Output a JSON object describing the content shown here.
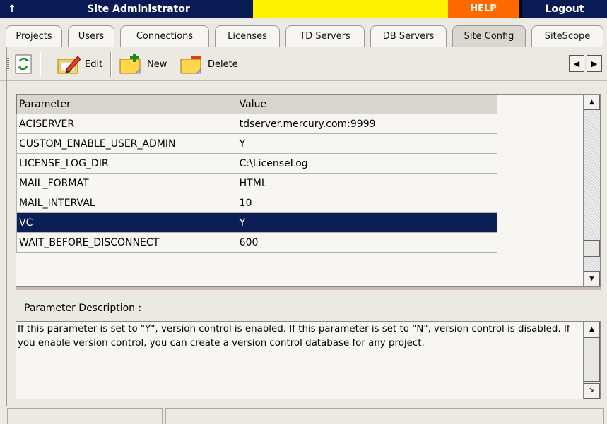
{
  "titlebar": {
    "up_glyph": "↑",
    "title": "Site Administrator",
    "help": "HELP",
    "logout": "Logout"
  },
  "tabs": [
    {
      "label": "Projects",
      "active": false
    },
    {
      "label": "Users",
      "active": false
    },
    {
      "label": "Connections",
      "active": false
    },
    {
      "label": "Licenses",
      "active": false
    },
    {
      "label": "TD Servers",
      "active": false
    },
    {
      "label": "DB Servers",
      "active": false
    },
    {
      "label": "Site Config",
      "active": true
    },
    {
      "label": "SiteScope",
      "active": false
    }
  ],
  "toolbar": {
    "refresh_icon": "refresh-icon",
    "edit_label": "Edit",
    "new_label": "New",
    "delete_label": "Delete",
    "prev_glyph": "◀",
    "next_glyph": "▶"
  },
  "grid": {
    "columns": [
      "Parameter",
      "Value"
    ],
    "rows": [
      {
        "parameter": "ACISERVER",
        "value": "tdserver.mercury.com:9999"
      },
      {
        "parameter": "CUSTOM_ENABLE_USER_ADMIN",
        "value": "Y"
      },
      {
        "parameter": "LICENSE_LOG_DIR",
        "value": "C:\\LicenseLog"
      },
      {
        "parameter": "MAIL_FORMAT",
        "value": "HTML"
      },
      {
        "parameter": "MAIL_INTERVAL",
        "value": "10"
      },
      {
        "parameter": "VC",
        "value": "Y"
      },
      {
        "parameter": "WAIT_BEFORE_DISCONNECT",
        "value": "600"
      }
    ],
    "selected_index": 5
  },
  "description": {
    "label": "Parameter Description :",
    "text": "If this parameter is set to \"Y\", version control is enabled. If this parameter is set to \"N\", version control is disabled. If you enable version control, you can create a version control database for any project."
  },
  "colors": {
    "title_navy": "#0a1a55",
    "help_orange": "#ff6a00",
    "yellow_band": "#fff200",
    "selected_row": "#0b1d55"
  }
}
